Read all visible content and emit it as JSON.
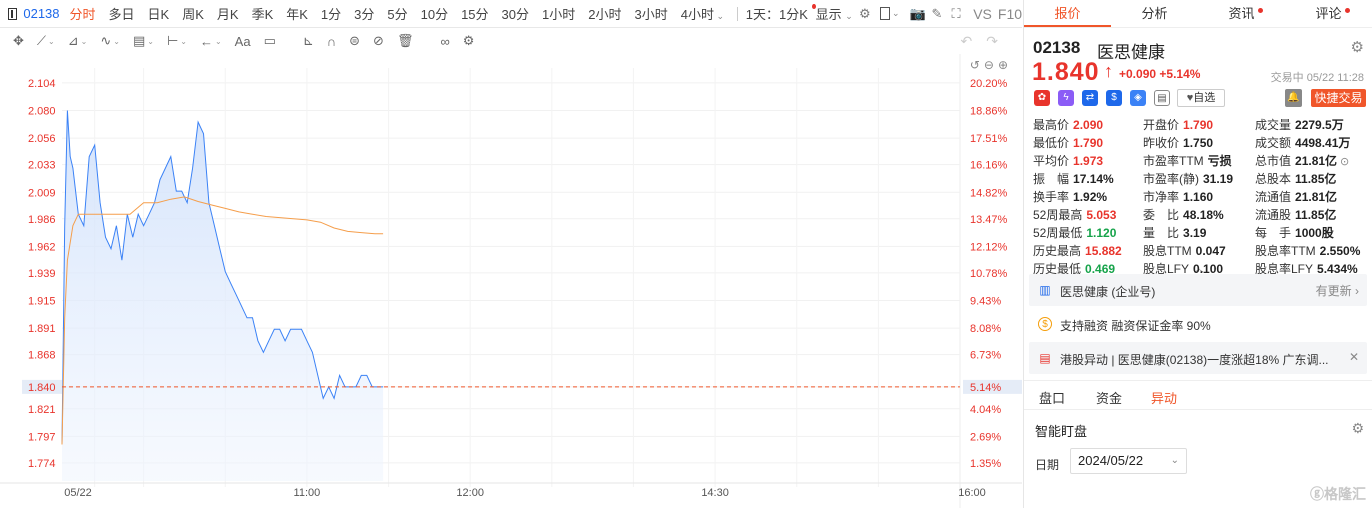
{
  "toolbar": {
    "stock_code": "02138",
    "periods": [
      "分时",
      "多日",
      "日K",
      "周K",
      "月K",
      "季K",
      "年K",
      "1分",
      "3分",
      "5分",
      "10分",
      "15分",
      "30分",
      "1小时",
      "2小时",
      "3小时",
      "4小时"
    ],
    "active_period": "分时",
    "range_label": "1天：1分K",
    "display_label": "显示",
    "vs_label": "VS",
    "f10_label": "F10"
  },
  "chart": {
    "price_axis": [
      "2.104",
      "2.080",
      "2.056",
      "2.033",
      "2.009",
      "1.986",
      "1.962",
      "1.939",
      "1.915",
      "1.891",
      "1.868",
      "1.840",
      "1.821",
      "1.797",
      "1.774"
    ],
    "pct_axis": [
      "20.20%",
      "18.86%",
      "17.51%",
      "16.16%",
      "14.82%",
      "13.47%",
      "12.12%",
      "10.78%",
      "9.43%",
      "8.08%",
      "6.73%",
      "5.14%",
      "4.04%",
      "2.69%",
      "1.35%"
    ],
    "time_labels": [
      "05/22",
      "11:00",
      "12:00",
      "14:30",
      "16:00"
    ],
    "current_price": "1.840",
    "current_pct": "5.14%"
  },
  "chart_data": {
    "type": "line",
    "title": "",
    "xlabel": "",
    "ylabel": "",
    "x_range": [
      "09:30",
      "16:00"
    ],
    "ylim": [
      1.76,
      2.11
    ],
    "series": [
      {
        "name": "",
        "x": [
          "09:30",
          "09:31",
          "09:32",
          "09:33",
          "09:34",
          "09:36",
          "09:38",
          "09:40",
          "09:42",
          "09:44",
          "09:46",
          "09:48",
          "09:50",
          "09:52",
          "09:54",
          "09:56",
          "09:58",
          "10:00",
          "10:02",
          "10:04",
          "10:06",
          "10:08",
          "10:10",
          "10:12",
          "10:14",
          "10:16",
          "10:18",
          "10:20",
          "10:22",
          "10:24",
          "10:26",
          "10:28",
          "10:30",
          "10:32",
          "10:34",
          "10:36",
          "10:38",
          "10:40",
          "10:42",
          "10:44",
          "10:46",
          "10:48",
          "10:50",
          "10:52",
          "10:54",
          "10:56",
          "10:58",
          "11:00",
          "11:02",
          "11:04",
          "11:06",
          "11:08",
          "11:10",
          "11:12",
          "11:14",
          "11:16",
          "11:18",
          "11:20",
          "11:22",
          "11:24",
          "11:26",
          "11:28"
        ],
        "values": [
          1.79,
          1.98,
          2.08,
          2.04,
          2.03,
          1.99,
          1.98,
          2.04,
          2.05,
          2.0,
          1.97,
          1.96,
          1.98,
          1.95,
          1.99,
          1.97,
          1.99,
          1.98,
          1.99,
          2.0,
          2.02,
          2.03,
          2.04,
          2.01,
          2.01,
          2.0,
          2.03,
          2.07,
          2.06,
          2.0,
          1.98,
          1.96,
          1.94,
          1.93,
          1.92,
          1.91,
          1.9,
          1.9,
          1.88,
          1.87,
          1.88,
          1.89,
          1.89,
          1.88,
          1.89,
          1.89,
          1.89,
          1.88,
          1.87,
          1.85,
          1.83,
          1.84,
          1.83,
          1.85,
          1.84,
          1.84,
          1.84,
          1.85,
          1.85,
          1.84,
          1.84,
          1.84
        ]
      },
      {
        "name": "",
        "x": [
          "09:30",
          "09:31",
          "09:32",
          "09:34",
          "09:36",
          "09:40",
          "09:45",
          "09:50",
          "09:55",
          "10:00",
          "10:05",
          "10:10",
          "10:15",
          "10:20",
          "10:25",
          "10:30",
          "10:35",
          "10:40",
          "10:45",
          "10:50",
          "10:55",
          "11:00",
          "11:05",
          "11:10",
          "11:15",
          "11:20",
          "11:25",
          "11:28"
        ],
        "values": [
          1.79,
          1.9,
          1.95,
          1.98,
          1.99,
          1.99,
          1.99,
          1.99,
          1.99,
          2.0,
          2.0,
          2.003,
          2.005,
          2.001,
          1.998,
          1.995,
          1.992,
          1.99,
          1.988,
          1.987,
          1.986,
          1.985,
          1.983,
          1.978,
          1.975,
          1.974,
          1.973,
          1.973
        ]
      }
    ]
  },
  "right_panel": {
    "tabs": [
      "报价",
      "分析",
      "资讯",
      "评论"
    ],
    "active_tab": "报价",
    "code": "02138",
    "name": "医思健康",
    "price": "1.840",
    "change": "+0.090",
    "change_pct": "+5.14%",
    "status": "交易中 05/22 11:28",
    "watch_label": "自选",
    "trade_label": "快捷交易",
    "stats": [
      [
        {
          "label": "最高价",
          "value": "2.090",
          "cls": "up"
        },
        {
          "label": "开盘价",
          "value": "1.790",
          "cls": "up"
        },
        {
          "label": "成交量",
          "value": "2279.5万",
          "cls": ""
        }
      ],
      [
        {
          "label": "最低价",
          "value": "1.790",
          "cls": "up"
        },
        {
          "label": "昨收价",
          "value": "1.750",
          "cls": ""
        },
        {
          "label": "成交额",
          "value": "4498.41万",
          "cls": ""
        }
      ],
      [
        {
          "label": "平均价",
          "value": "1.973",
          "cls": "up"
        },
        {
          "label": "市盈率TTM",
          "value": "亏损",
          "cls": ""
        },
        {
          "label": "总市值",
          "value": "21.81亿",
          "cls": ""
        }
      ],
      [
        {
          "label": "振　幅",
          "value": "17.14%",
          "cls": ""
        },
        {
          "label": "市盈率(静)",
          "value": "31.19",
          "cls": ""
        },
        {
          "label": "总股本",
          "value": "11.85亿",
          "cls": ""
        }
      ],
      [
        {
          "label": "换手率",
          "value": "1.92%",
          "cls": ""
        },
        {
          "label": "市净率",
          "value": "1.160",
          "cls": ""
        },
        {
          "label": "流通值",
          "value": "21.81亿",
          "cls": ""
        }
      ],
      [
        {
          "label": "52周最高",
          "value": "5.053",
          "cls": "up"
        },
        {
          "label": "委　比",
          "value": "48.18%",
          "cls": ""
        },
        {
          "label": "流通股",
          "value": "11.85亿",
          "cls": ""
        }
      ],
      [
        {
          "label": "52周最低",
          "value": "1.120",
          "cls": "down"
        },
        {
          "label": "量　比",
          "value": "3.19",
          "cls": ""
        },
        {
          "label": "每　手",
          "value": "1000股",
          "cls": ""
        }
      ],
      [
        {
          "label": "历史最高",
          "value": "15.882",
          "cls": "up"
        },
        {
          "label": "股息TTM",
          "value": "0.047",
          "cls": ""
        },
        {
          "label": "股息率TTM",
          "value": "2.550%",
          "cls": ""
        }
      ],
      [
        {
          "label": "历史最低",
          "value": "0.469",
          "cls": "down"
        },
        {
          "label": "股息LFY",
          "value": "0.100",
          "cls": ""
        },
        {
          "label": "股息率LFY",
          "value": "5.434%",
          "cls": ""
        }
      ]
    ],
    "info_rows": [
      {
        "icon": "building-icon",
        "text": "医思健康 (企业号)",
        "right": "有更新 ›"
      },
      {
        "icon": "coin-icon",
        "text": "支持融资 融资保证金率 90%",
        "right": ""
      },
      {
        "icon": "news-icon",
        "text": "港股异动 | 医思健康(02138)一度涨超18% 广东调...",
        "right": "✕"
      }
    ],
    "sub_tabs": [
      "盘口",
      "资金",
      "异动"
    ],
    "active_sub_tab": "异动",
    "smart_title": "智能盯盘",
    "date_label": "日期",
    "date_value": "2024/05/22",
    "watermark": "ⓖ格隆汇"
  },
  "colors": {
    "accent": "#f0562a",
    "up": "#e8342c",
    "down": "#16a34a",
    "price_line": "#3b82f6",
    "avg_line": "#f59e4b",
    "link_blue": "#1e68ea"
  }
}
